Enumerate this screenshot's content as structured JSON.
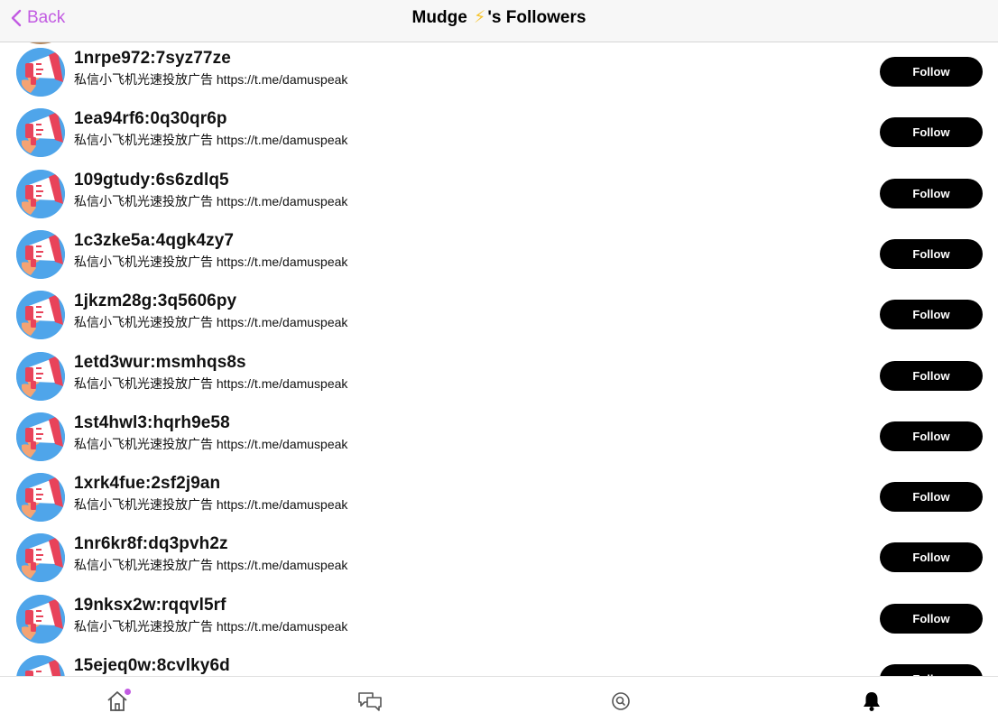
{
  "header": {
    "back_label": "Back",
    "title_prefix": "Mudge",
    "title_emoji": "⚡",
    "title_suffix": "'s Followers"
  },
  "colors": {
    "accent": "#c25be2",
    "follow_bg": "#000000",
    "avatar_bg": "#4fa5ea",
    "bolt": "#f7c531"
  },
  "followers": [
    {
      "name": "1nrpe972:7syz77ze",
      "bio": "私信小飞机光速投放广告 https://t.me/damuspeak",
      "button": "Follow"
    },
    {
      "name": "1ea94rf6:0q30qr6p",
      "bio": "私信小飞机光速投放广告 https://t.me/damuspeak",
      "button": "Follow"
    },
    {
      "name": "109gtudy:6s6zdlq5",
      "bio": "私信小飞机光速投放广告 https://t.me/damuspeak",
      "button": "Follow"
    },
    {
      "name": "1c3zke5a:4qgk4zy7",
      "bio": "私信小飞机光速投放广告 https://t.me/damuspeak",
      "button": "Follow"
    },
    {
      "name": "1jkzm28g:3q5606py",
      "bio": "私信小飞机光速投放广告 https://t.me/damuspeak",
      "button": "Follow"
    },
    {
      "name": "1etd3wur:msmhqs8s",
      "bio": "私信小飞机光速投放广告 https://t.me/damuspeak",
      "button": "Follow"
    },
    {
      "name": "1st4hwl3:hqrh9e58",
      "bio": "私信小飞机光速投放广告 https://t.me/damuspeak",
      "button": "Follow"
    },
    {
      "name": "1xrk4fue:2sf2j9an",
      "bio": "私信小飞机光速投放广告 https://t.me/damuspeak",
      "button": "Follow"
    },
    {
      "name": "1nr6kr8f:dq3pvh2z",
      "bio": "私信小飞机光速投放广告 https://t.me/damuspeak",
      "button": "Follow"
    },
    {
      "name": "19nksx2w:rqqvl5rf",
      "bio": "私信小飞机光速投放广告 https://t.me/damuspeak",
      "button": "Follow"
    },
    {
      "name": "15ejeq0w:8cvlky6d",
      "bio": "",
      "button": "Follow"
    }
  ],
  "tabs": {
    "home": "home-icon",
    "dms": "messages-icon",
    "search": "search-icon",
    "notifications": "bell-icon"
  }
}
